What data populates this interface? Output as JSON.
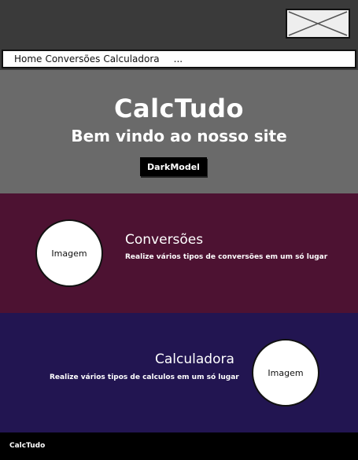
{
  "nav": {
    "links": [
      "Home",
      "Conversões",
      "Calculadora"
    ],
    "more": "..."
  },
  "logo": {
    "icon": "image-placeholder-icon"
  },
  "hero": {
    "title": "CalcTudo",
    "subtitle": "Bem vindo ao nosso site",
    "dark_button": "DarkModel"
  },
  "sections": [
    {
      "title": "Conversões",
      "description": "Realize vários tipos de conversões em um só lugar",
      "image_label": "Imagem",
      "background": "#4d1232"
    },
    {
      "title": "Calculadora",
      "description": "Realize vários tipos de calculos em um só lugar",
      "image_label": "Imagem",
      "background": "#221551"
    }
  ],
  "footer": {
    "brand": "CalcTudo"
  },
  "colors": {
    "topbar": "#3a3a3a",
    "hero": "#6a6a6a",
    "footer": "#000000"
  }
}
